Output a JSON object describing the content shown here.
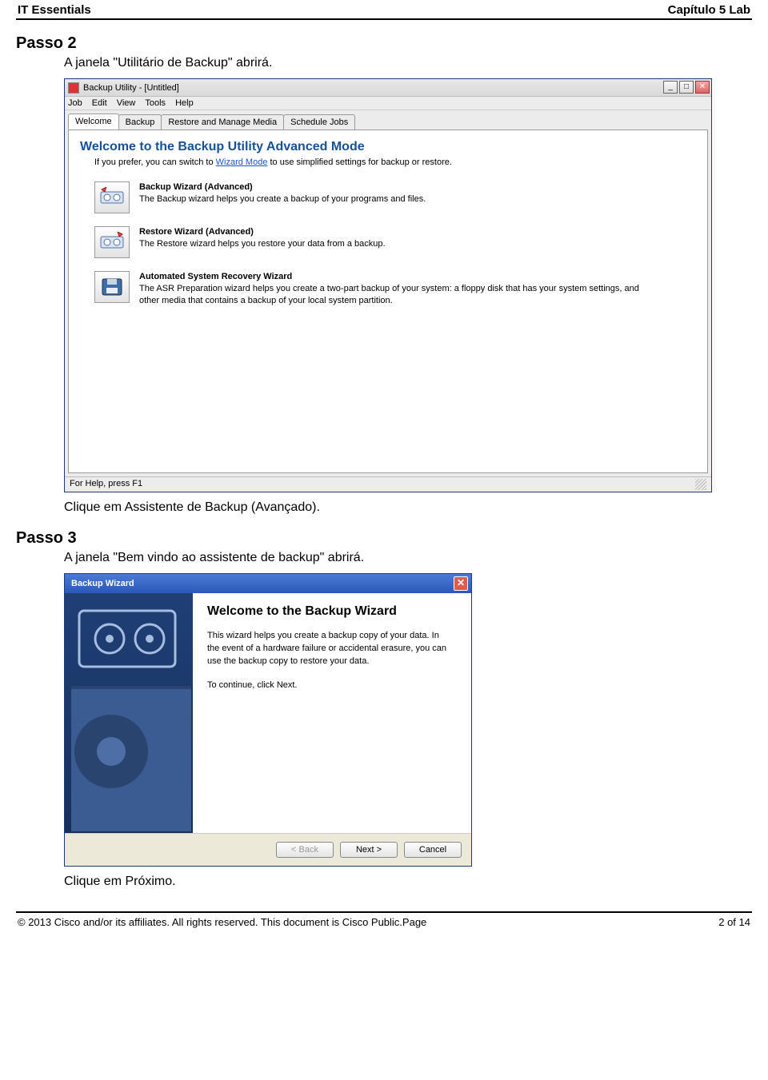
{
  "doc": {
    "header_left": "IT Essentials",
    "header_right": "Capítulo 5 Lab",
    "footer_left": "© 2013 Cisco and/or its affiliates. All rights reserved. This document is Cisco Public.Page",
    "footer_right": "2 of 14"
  },
  "step2": {
    "heading": "Passo 2",
    "text1": "A janela \"Utilitário de Backup\" abrirá.",
    "text2": "Clique em Assistente de Backup (Avançado)."
  },
  "step3": {
    "heading": "Passo 3",
    "text1": "A janela \"Bem vindo ao assistente de backup\" abrirá.",
    "text2": "Clique em Próximo."
  },
  "utility": {
    "title": "Backup Utility - [Untitled]",
    "menu": [
      "Job",
      "Edit",
      "View",
      "Tools",
      "Help"
    ],
    "tabs": [
      "Welcome",
      "Backup",
      "Restore and Manage Media",
      "Schedule Jobs"
    ],
    "welcome_heading": "Welcome to the Backup Utility Advanced Mode",
    "intro_prefix": "If you prefer, you can switch to ",
    "intro_link": "Wizard Mode",
    "intro_suffix": " to use simplified settings for backup or restore.",
    "options": [
      {
        "title": "Backup Wizard (Advanced)",
        "desc": "The Backup wizard helps you create a backup of your programs and files."
      },
      {
        "title": "Restore Wizard (Advanced)",
        "desc": "The Restore wizard helps you restore your data from a backup."
      },
      {
        "title": "Automated System Recovery Wizard",
        "desc": "The ASR Preparation wizard helps you create a two-part backup of your system: a floppy disk that has your system settings, and other media that contains a backup of your local system partition."
      }
    ],
    "status_text": "For Help, press F1"
  },
  "wizard": {
    "title": "Backup Wizard",
    "heading": "Welcome to the Backup Wizard",
    "para1": "This wizard helps you create a backup copy of your data. In the event of a hardware failure or accidental erasure, you can use the backup copy to restore your data.",
    "para2": "To continue, click Next.",
    "buttons": {
      "back": "< Back",
      "next": "Next >",
      "cancel": "Cancel"
    }
  }
}
